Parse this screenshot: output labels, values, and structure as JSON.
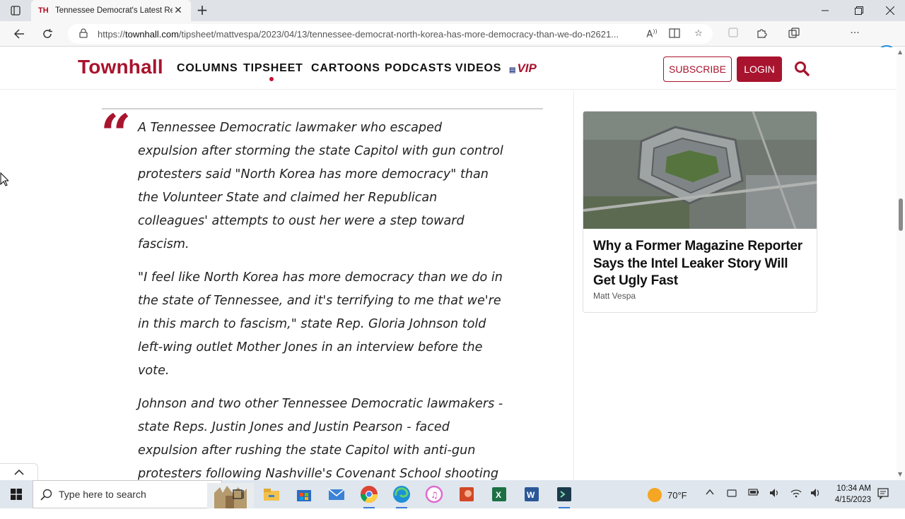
{
  "browser": {
    "tab_favicon": "TH",
    "tab_title": "Tennessee Democrat's Latest Re",
    "url_prefix": "https://",
    "url_domain": "townhall.com",
    "url_path": "/tipsheet/mattvespa/2023/04/13/tennessee-democrat-north-korea-has-more-democracy-than-we-do-n2621...",
    "bing_label": "b"
  },
  "site": {
    "logo": "Townhall",
    "nav": [
      {
        "label": "COLUMNS"
      },
      {
        "label": "TIPSHEET"
      },
      {
        "label": "CARTOONS"
      },
      {
        "label": "PODCASTS"
      },
      {
        "label": "VIDEOS"
      }
    ],
    "vip_label": "VIP",
    "subscribe_label": "SUBSCRIBE",
    "login_label": "LOGIN"
  },
  "article": {
    "quote_mark": "“",
    "paragraphs": [
      "A Tennessee Democratic lawmaker who escaped expulsion after storming the state Capitol with gun control protesters said \"North Korea has more democracy\" than the Volunteer State and claimed her Republican colleagues' attempts to oust her were a step toward fascism.",
      "\"I feel like North Korea has more democracy than we do in the state of Tennessee, and it's terrifying to me that we're in this march to fascism,\" state Rep. Gloria Johnson told left-wing outlet Mother Jones in an interview before the vote.",
      "Johnson and two other Tennessee Democratic lawmakers - state Reps. Justin Jones and Justin Pearson - faced expulsion after rushing the state Capitol with anti-gun protesters following Nashville's Covenant School shooting that left three adults and three children dead."
    ]
  },
  "sidebar": {
    "card_title": "Why a Former Magazine Reporter Says the Intel Leaker Story Will Get Ugly Fast",
    "card_author": "Matt Vespa"
  },
  "taskbar": {
    "search_placeholder": "Type here to search",
    "temperature": "70°F",
    "time": "10:34 AM",
    "date": "4/15/2023"
  },
  "colors": {
    "brand": "#a8142e",
    "taskbar": "#dfe6ee"
  }
}
